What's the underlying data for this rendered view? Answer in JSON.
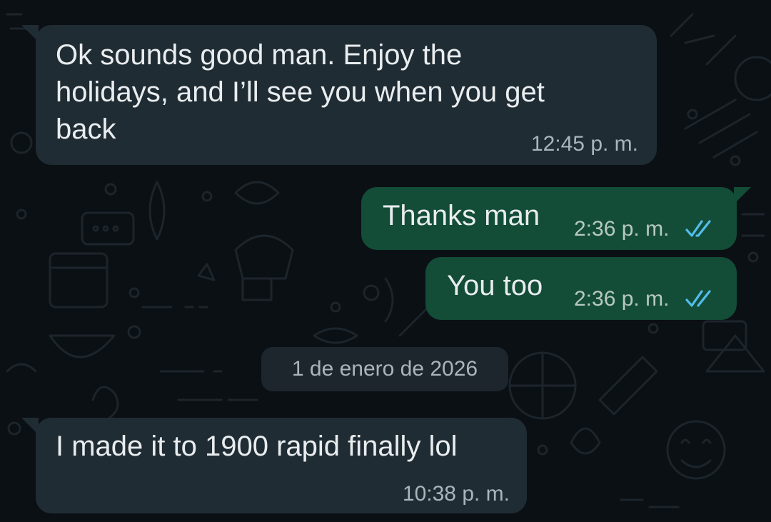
{
  "messages": [
    {
      "direction": "incoming",
      "text": "Ok sounds good man. Enjoy the\nholidays, and I’ll see you when you get\nback",
      "time": "12:45 p. m."
    },
    {
      "direction": "outgoing",
      "text": "Thanks man",
      "time": "2:36 p. m.",
      "status": "read"
    },
    {
      "direction": "outgoing",
      "text": "You too",
      "time": "2:36 p. m.",
      "status": "read"
    },
    {
      "direction": "incoming",
      "text": "I made it to 1900 rapid finally lol",
      "time": "10:38 p. m."
    }
  ],
  "date_separator": "1 de enero de 2026",
  "colors": {
    "background": "#0b1014",
    "incoming_bubble": "#202c33",
    "outgoing_bubble": "#134d37",
    "read_ticks": "#53bdeb",
    "text": "#e9edef",
    "meta_text": "#aab5bb"
  },
  "icons": {
    "read_receipt": "double-check-icon",
    "wallpaper": "doodle-pattern"
  }
}
